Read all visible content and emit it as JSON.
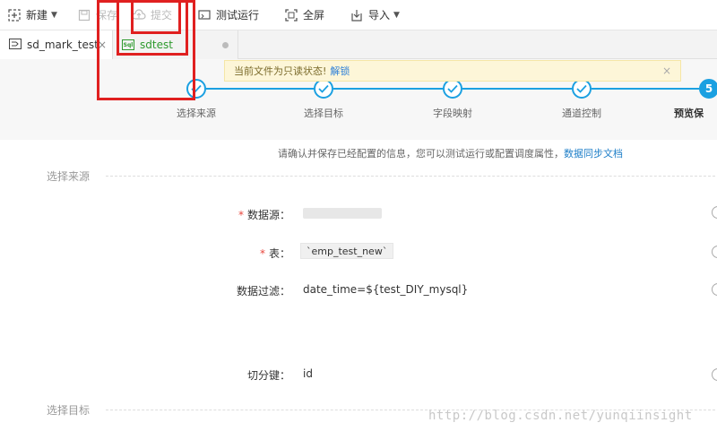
{
  "toolbar": {
    "new_label": "新建",
    "save_label": "保存",
    "submit_label": "提交",
    "test_run_label": "测试运行",
    "fullscreen_label": "全屏",
    "import_label": "导入"
  },
  "tabs": [
    {
      "label": "sd_mark_test",
      "close": "×"
    },
    {
      "label": "sdtest",
      "icon_text": "Sql"
    }
  ],
  "notice": {
    "text": "当前文件为只读状态!",
    "unlock_link": "解锁",
    "close": "×"
  },
  "steps": [
    {
      "label": "选择来源",
      "status": "done"
    },
    {
      "label": "选择目标",
      "status": "done"
    },
    {
      "label": "字段映射",
      "status": "done"
    },
    {
      "label": "通道控制",
      "status": "done"
    },
    {
      "label": "预览保",
      "status": "active",
      "number": "5"
    }
  ],
  "confirm": {
    "text": "请确认并保存已经配置的信息，您可以测试运行或配置调度属性，",
    "doc_link": "数据同步文档"
  },
  "source_section": {
    "title": "选择来源",
    "datasource_label": "数据源：",
    "table_label": "表：",
    "table_value": "`emp_test_new`",
    "filter_label": "数据过滤：",
    "filter_value": "date_time=${test_DIY_mysql}",
    "split_key_label": "切分键：",
    "split_key_value": "id",
    "required_mark": "*"
  },
  "target_section": {
    "title": "选择目标"
  },
  "watermark": "http://blog.csdn.net/yunqiinsight",
  "colors": {
    "accent": "#1ba0e1",
    "annotation_red": "#e02020",
    "link": "#1f7fc8"
  }
}
